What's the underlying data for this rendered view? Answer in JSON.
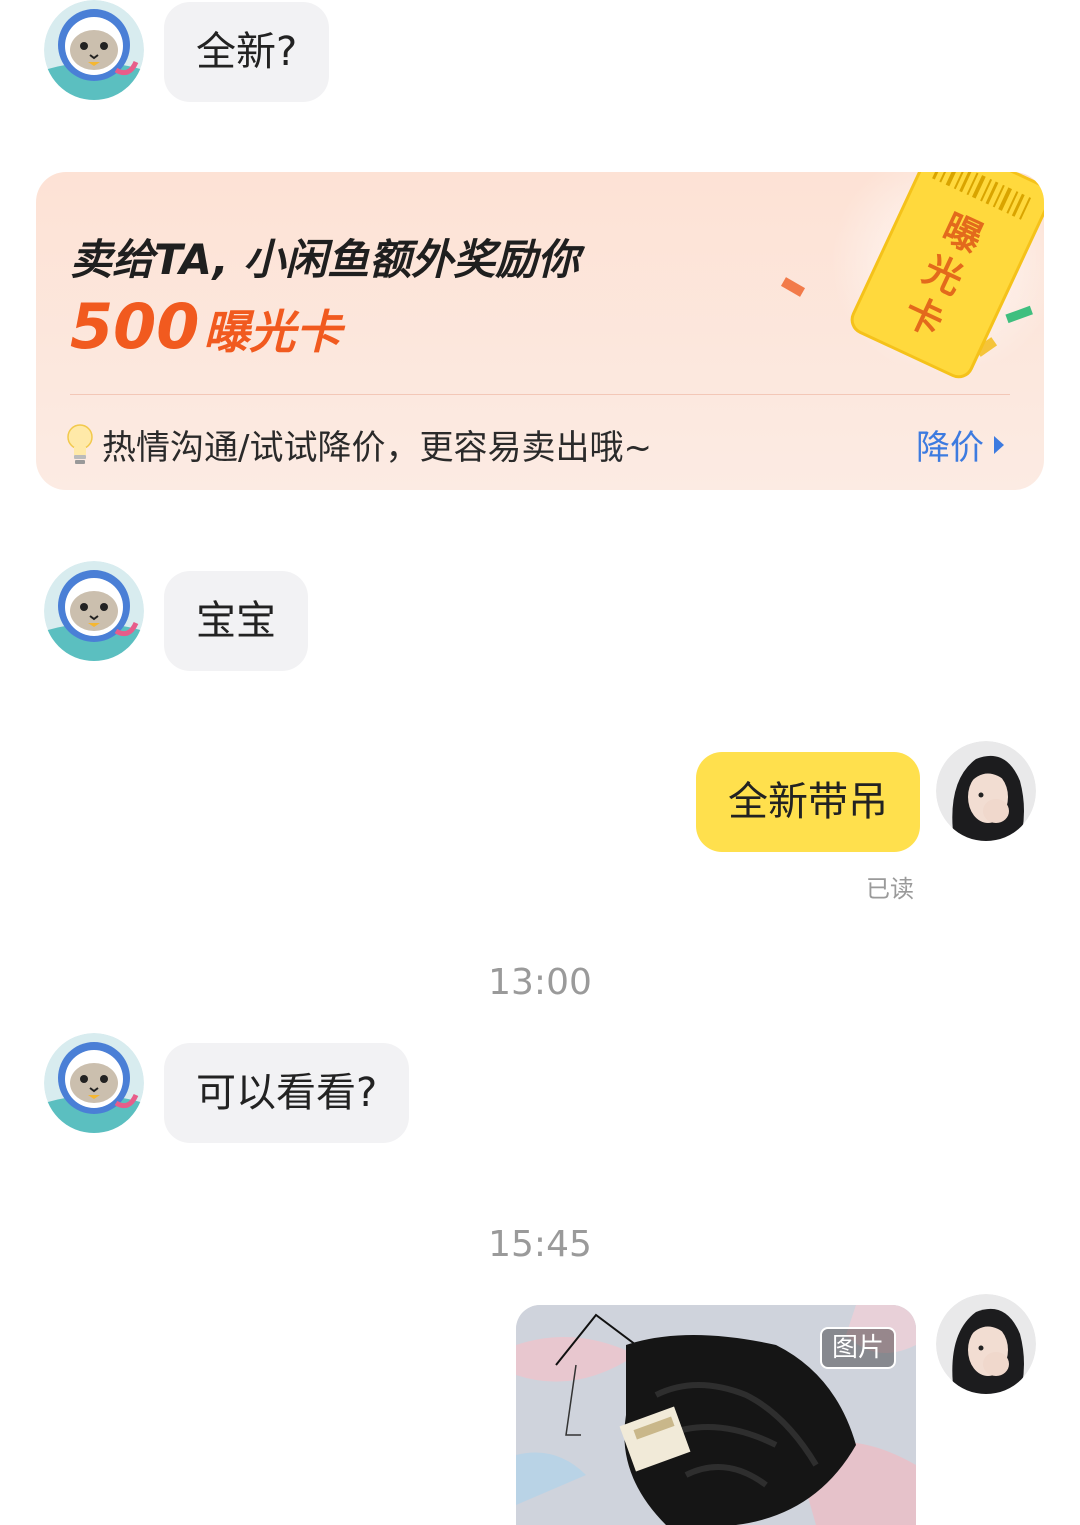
{
  "messages": {
    "m1": {
      "text": "全新?"
    },
    "m2": {
      "text": "宝宝"
    },
    "m3": {
      "text": "全新带吊",
      "status": "已读"
    },
    "m4": {
      "text": "可以看看?"
    }
  },
  "timestamps": [
    "13:00",
    "15:45"
  ],
  "promo": {
    "title": "卖给TA, 小闲鱼额外奖励你",
    "amount": "500",
    "amount_unit": "曝光卡",
    "ticket_text": "曝光卡",
    "tip": "热情沟通/试试降价，更容易卖出哦~",
    "action": "降价"
  },
  "image_message": {
    "badge": "图片"
  },
  "icons": {
    "buyer_avatar": "cat-astronaut-avatar",
    "seller_avatar": "user-photo-avatar",
    "tip_icon": "lightbulb-icon",
    "action_icon": "chevron-right-icon"
  },
  "colors": {
    "outgoing_bubble": "#ffe04d",
    "incoming_bubble": "#f2f2f4",
    "promo_accent": "#f15a1f",
    "link_blue": "#3d7be0"
  }
}
